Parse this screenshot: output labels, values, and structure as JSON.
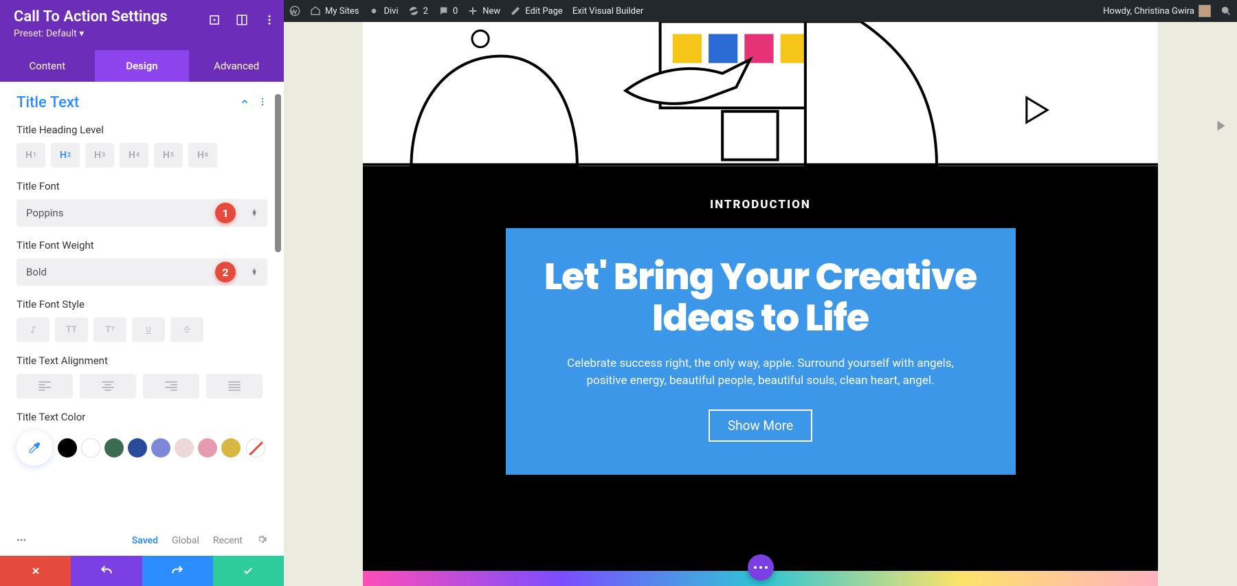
{
  "settings": {
    "title": "Call To Action Settings",
    "preset_label": "Preset: Default ▾",
    "tabs": {
      "content": "Content",
      "design": "Design",
      "advanced": "Advanced",
      "active": "design"
    },
    "section": "Title Text",
    "fields": {
      "heading_level": {
        "label": "Title Heading Level",
        "options": [
          "1",
          "2",
          "3",
          "4",
          "5",
          "6"
        ],
        "active": "2"
      },
      "font": {
        "label": "Title Font",
        "value": "Poppins",
        "badge": "1"
      },
      "weight": {
        "label": "Title Font Weight",
        "value": "Bold",
        "badge": "2"
      },
      "style": {
        "label": "Title Font Style"
      },
      "alignment": {
        "label": "Title Text Alignment"
      },
      "color": {
        "label": "Title Text Color",
        "swatches": [
          "#000000",
          "#ffffff",
          "#3d6b52",
          "#2a4b99",
          "#7d88d9",
          "#f0d7d7",
          "#e79bb0",
          "#d8b742"
        ]
      }
    },
    "scope": {
      "saved": "Saved",
      "global": "Global",
      "recent": "Recent"
    }
  },
  "admin_bar": {
    "my_sites": "My Sites",
    "divi": "Divi",
    "updates": "2",
    "comments": "0",
    "new": "New",
    "edit": "Edit Page",
    "exit": "Exit Visual Builder",
    "howdy": "Howdy, Christina Gwira"
  },
  "cta": {
    "section_label": "INTRODUCTION",
    "title": "Let' Bring Your Creative Ideas to Life",
    "desc": "Celebrate success right, the only way, apple. Surround yourself with angels, positive energy, beautiful people, beautiful souls, clean heart, angel.",
    "button": "Show More"
  }
}
